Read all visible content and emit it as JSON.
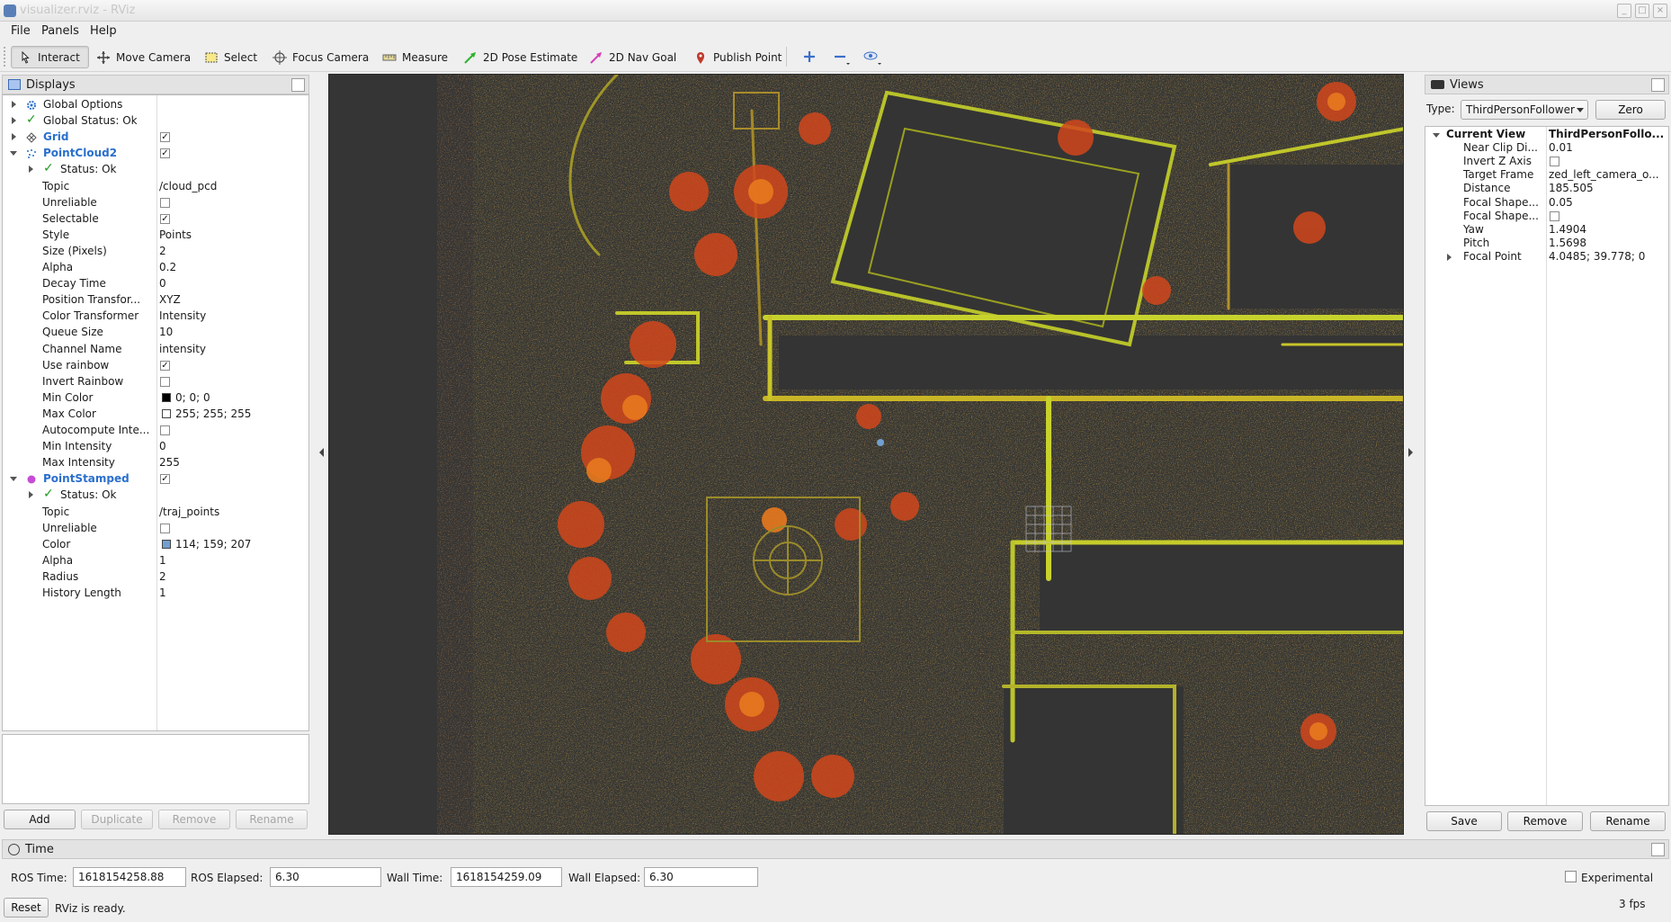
{
  "window": {
    "title": "visualizer.rviz - RViz"
  },
  "menu": [
    {
      "label": "File"
    },
    {
      "label": "Panels"
    },
    {
      "label": "Help"
    }
  ],
  "toolbar": {
    "tools": [
      {
        "label": "Interact",
        "icon": "interact-cursor-icon"
      },
      {
        "label": "Move Camera",
        "icon": "move-camera-icon"
      },
      {
        "label": "Select",
        "icon": "select-box-icon"
      },
      {
        "label": "Focus Camera",
        "icon": "focus-camera-icon"
      },
      {
        "label": "Measure",
        "icon": "ruler-icon"
      },
      {
        "label": "2D Pose Estimate",
        "icon": "pose-arrow-icon"
      },
      {
        "label": "2D Nav Goal",
        "icon": "nav-goal-arrow-icon"
      },
      {
        "label": "Publish Point",
        "icon": "map-pin-icon"
      }
    ]
  },
  "displays": {
    "title": "Displays",
    "rows": {
      "global_options": "Global Options",
      "global_status": "Global Status: Ok",
      "grid": "Grid",
      "pointcloud2": "PointCloud2",
      "pc_status": "Status: Ok",
      "pc_props": [
        {
          "key": "Topic",
          "value": "/cloud_pcd"
        },
        {
          "key": "Unreliable",
          "value": ""
        },
        {
          "key": "Selectable",
          "value": ""
        },
        {
          "key": "Style",
          "value": "Points"
        },
        {
          "key": "Size (Pixels)",
          "value": "2"
        },
        {
          "key": "Alpha",
          "value": "0.2"
        },
        {
          "key": "Decay Time",
          "value": "0"
        },
        {
          "key": "Position Transfor...",
          "value": "XYZ"
        },
        {
          "key": "Color Transformer",
          "value": "Intensity"
        },
        {
          "key": "Queue Size",
          "value": "10"
        },
        {
          "key": "Channel Name",
          "value": "intensity"
        },
        {
          "key": "Use rainbow",
          "value": ""
        },
        {
          "key": "Invert Rainbow",
          "value": ""
        },
        {
          "key": "Min Color",
          "value": "0; 0; 0"
        },
        {
          "key": "Max Color",
          "value": "255; 255; 255"
        },
        {
          "key": "Autocompute Inte...",
          "value": ""
        },
        {
          "key": "Min Intensity",
          "value": "0"
        },
        {
          "key": "Max Intensity",
          "value": "255"
        }
      ],
      "pointstamped": "PointStamped",
      "ps_status": "Status: Ok",
      "ps_props": [
        {
          "key": "Topic",
          "value": "/traj_points"
        },
        {
          "key": "Unreliable",
          "value": ""
        },
        {
          "key": "Color",
          "value": "114; 159; 207"
        },
        {
          "key": "Alpha",
          "value": "1"
        },
        {
          "key": "Radius",
          "value": "2"
        },
        {
          "key": "History Length",
          "value": "1"
        }
      ]
    },
    "checks": {
      "grid": true,
      "pointcloud2": true,
      "unreliable": false,
      "selectable": true,
      "use_rainbow": true,
      "invert_rainbow": false,
      "autocompute": false,
      "pointstamped": true,
      "ps_unreliable": false
    },
    "colors": {
      "min": "#000000",
      "max": "#ffffff",
      "ps": "#729fcf"
    },
    "buttons": {
      "add": "Add",
      "duplicate": "Duplicate",
      "remove": "Remove",
      "rename": "Rename"
    }
  },
  "views": {
    "title": "Views",
    "type_label": "Type:",
    "type_value": "ThirdPersonFollower",
    "zero": "Zero",
    "current_view": "Current View",
    "current_view_type": "ThirdPersonFollo...",
    "props": [
      {
        "key": "Near Clip Di...",
        "value": "0.01"
      },
      {
        "key": "Invert Z Axis",
        "value": ""
      },
      {
        "key": "Target Frame",
        "value": "zed_left_camera_o..."
      },
      {
        "key": "Distance",
        "value": "185.505"
      },
      {
        "key": "Focal Shape...",
        "value": "0.05"
      },
      {
        "key": "Focal Shape...",
        "value": ""
      },
      {
        "key": "Yaw",
        "value": "1.4904"
      },
      {
        "key": "Pitch",
        "value": "1.5698"
      },
      {
        "key": "Focal Point",
        "value": "4.0485; 39.778; 0"
      }
    ],
    "buttons": {
      "save": "Save",
      "remove": "Remove",
      "rename": "Rename"
    }
  },
  "time": {
    "title": "Time",
    "ros_time_label": "ROS Time:",
    "ros_time": "1618154258.88",
    "ros_elapsed_label": "ROS Elapsed:",
    "ros_elapsed": "6.30",
    "wall_time_label": "Wall Time:",
    "wall_time": "1618154259.09",
    "wall_elapsed_label": "Wall Elapsed:",
    "wall_elapsed": "6.30",
    "experimental": "Experimental"
  },
  "status": {
    "reset": "Reset",
    "message": "RViz is ready.",
    "fps": "3 fps"
  },
  "accent": {
    "link_blue": "#2a6fcc",
    "ok_green": "#1f9b1f",
    "viewport_bg": "#353535"
  }
}
